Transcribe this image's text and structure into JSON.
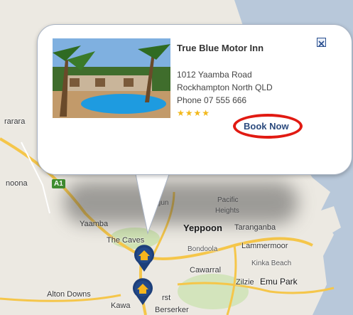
{
  "popup": {
    "title": "True Blue Motor Inn",
    "address_line1": "1012 Yaamba Road",
    "address_line2": "Rockhampton North QLD",
    "phone": "Phone 07 555 666",
    "rating_stars": "★★★★",
    "book_label": "Book Now",
    "photo": "motel-pool-photo",
    "close_icon": "close-icon"
  },
  "map": {
    "labels": {
      "rarara": "rarara",
      "noona": "noona",
      "a1": "A1",
      "bungundarra": "Bungun",
      "pacific_heights_1": "Pacific",
      "pacific_heights_2": "Heights",
      "yaamba": "Yaamba",
      "yeppoon": "Yeppoon",
      "taranganba": "Taranganba",
      "the_caves": "The Caves",
      "bondoola": "Bondoola",
      "lammermoor": "Lammermoor",
      "cawarral": "Cawarral",
      "kinka_beach": "Kinka Beach",
      "zilzie": "Zilzie",
      "emu_park": "Emu Park",
      "alton_downs": "Alton Downs",
      "kawana": "Kawa",
      "parkhurst": "rst",
      "berserker": "Berserker"
    },
    "colors": {
      "land": "#ece9e2",
      "water": "#b8c8da",
      "road": "#f5c64a",
      "marker": "#1d3f7a",
      "ring": "#e11a12"
    }
  }
}
